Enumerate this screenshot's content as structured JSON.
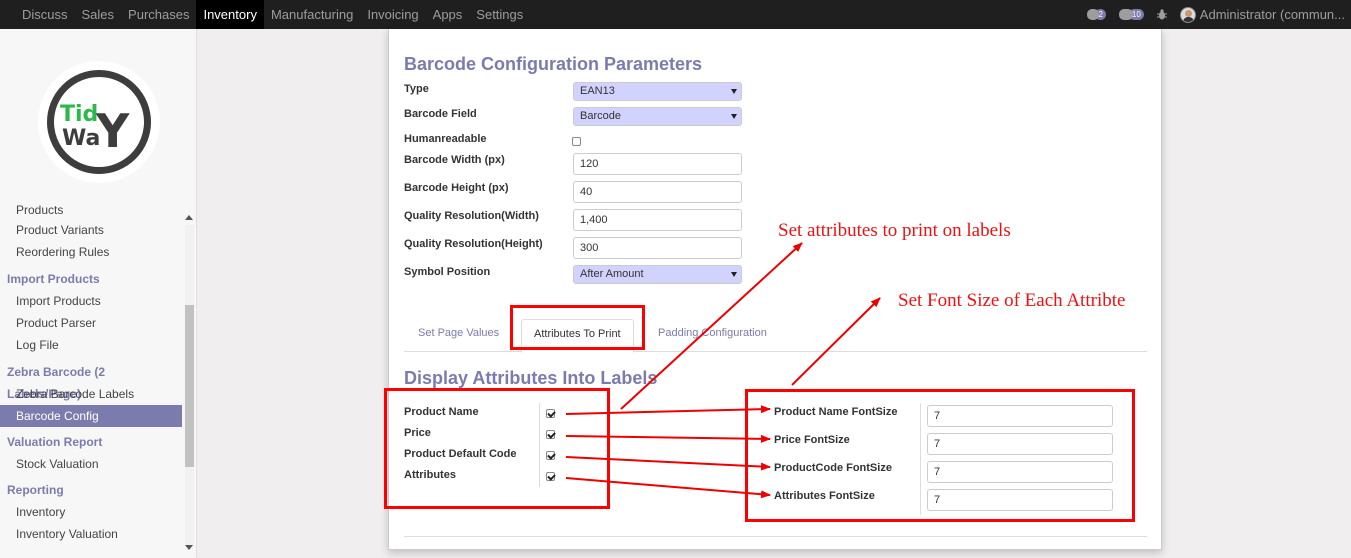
{
  "navbar": {
    "menu": [
      "Discuss",
      "Sales",
      "Purchases",
      "Inventory",
      "Manufacturing",
      "Invoicing",
      "Apps",
      "Settings"
    ],
    "active": "Inventory",
    "chat_count": "2",
    "activity_count": "10",
    "user": "Administrator (commun..."
  },
  "logo": {
    "line1": "Tid",
    "line2": "Wa",
    "letter": "Y"
  },
  "sidebar": {
    "partial_item": "Products",
    "items_top": [
      "Product Variants",
      "Reordering Rules"
    ],
    "import_head": "Import Products",
    "import_items": [
      "Import Products",
      "Product Parser",
      "Log File"
    ],
    "zebra_head": "Zebra Barcode (2 Labels/Page)",
    "zebra_items": [
      "Zebra Barcode Labels",
      "Barcode Config"
    ],
    "valuation_head": "Valuation Report",
    "valuation_items": [
      "Stock Valuation"
    ],
    "reporting_head": "Reporting",
    "reporting_items": [
      "Inventory",
      "Inventory Valuation"
    ]
  },
  "form": {
    "title": "Barcode Configuration Parameters",
    "type_label": "Type",
    "type_value": "EAN13",
    "field_label": "Barcode Field",
    "field_value": "Barcode",
    "humanreadable_label": "Humanreadable",
    "humanreadable_checked": false,
    "width_label": "Barcode Width (px)",
    "width_value": "120",
    "height_label": "Barcode Height (px)",
    "height_value": "40",
    "qres_w_label": "Quality Resolution(Width)",
    "qres_w_value": "1,400",
    "qres_h_label": "Quality Resolution(Height)",
    "qres_h_value": "300",
    "symbol_label": "Symbol Position",
    "symbol_value": "After Amount"
  },
  "tabs": [
    "Set Page Values",
    "Attributes To Print",
    "Padding Configuration"
  ],
  "active_tab": "Attributes To Print",
  "attributes": {
    "title": "Display Attributes Into Labels",
    "items": [
      {
        "label": "Product Name",
        "checked": true
      },
      {
        "label": "Price",
        "checked": true
      },
      {
        "label": "Product Default Code",
        "checked": true
      },
      {
        "label": "Attributes",
        "checked": true
      }
    ],
    "fontsizes": [
      {
        "label": "Product Name FontSize",
        "value": "7"
      },
      {
        "label": "Price FontSize",
        "value": "7"
      },
      {
        "label": "ProductCode FontSize",
        "value": "7"
      },
      {
        "label": "Attributes FontSize",
        "value": "7"
      }
    ]
  },
  "annotations": {
    "attributes_note": "Set attributes to print on labels",
    "fontsize_note": "Set Font Size of Each Attribte",
    "color": "#ff0000"
  },
  "colors": {
    "accent": "#7c7bad",
    "navbar": "#1f1f1f",
    "select_bg": "#d2d2ff"
  }
}
